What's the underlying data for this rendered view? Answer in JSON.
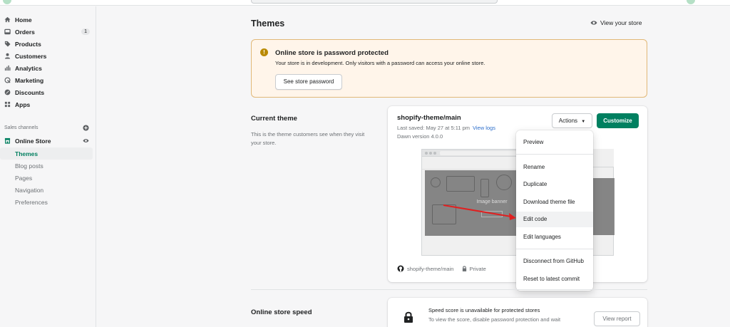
{
  "sidebar": {
    "items": [
      {
        "label": "Home",
        "icon": "home-icon"
      },
      {
        "label": "Orders",
        "icon": "orders-icon",
        "badge": "1"
      },
      {
        "label": "Products",
        "icon": "tag-icon"
      },
      {
        "label": "Customers",
        "icon": "person-icon"
      },
      {
        "label": "Analytics",
        "icon": "analytics-icon"
      },
      {
        "label": "Marketing",
        "icon": "marketing-icon"
      },
      {
        "label": "Discounts",
        "icon": "discount-icon"
      },
      {
        "label": "Apps",
        "icon": "apps-icon"
      }
    ],
    "sales_channels_label": "Sales channels",
    "online_store": {
      "label": "Online Store",
      "icon": "store-icon"
    },
    "sub_items": [
      {
        "label": "Themes",
        "active": true
      },
      {
        "label": "Blog posts"
      },
      {
        "label": "Pages"
      },
      {
        "label": "Navigation"
      },
      {
        "label": "Preferences"
      }
    ]
  },
  "header": {
    "title": "Themes",
    "view_store": "View your store"
  },
  "banner": {
    "title": "Online store is password protected",
    "description": "Your store is in development. Only visitors with a password can access your online store.",
    "button": "See store password"
  },
  "current_theme": {
    "section_title": "Current theme",
    "section_desc": "This is the theme customers see when they visit your store.",
    "theme_name": "shopify-theme/main",
    "last_saved": "Last saved: May 27 at 5:11 pm",
    "view_logs": "View logs",
    "version": "Dawn version 4.0.0",
    "actions": "Actions",
    "customize": "Customize",
    "preview_banner_text": "Image banner",
    "repo": "shopify-theme/main",
    "visibility": "Private"
  },
  "actions_menu": [
    {
      "label": "Preview"
    },
    {
      "label": "Rename"
    },
    {
      "label": "Duplicate"
    },
    {
      "label": "Download theme file"
    },
    {
      "label": "Edit code",
      "highlighted": true
    },
    {
      "label": "Edit languages"
    },
    {
      "label": "Disconnect from GitHub"
    },
    {
      "label": "Reset to latest commit"
    }
  ],
  "speed": {
    "section_title": "Online store speed",
    "title": "Speed score is unavailable for protected stores",
    "description": "To view the score, disable password protection and wait",
    "button": "View report"
  },
  "colors": {
    "accent": "#008060",
    "active_nav": "#007f5f",
    "link": "#2c6ecb",
    "warning_bg": "#fff5ea",
    "warning_icon": "#b98900",
    "annotation_arrow": "#e02020"
  }
}
